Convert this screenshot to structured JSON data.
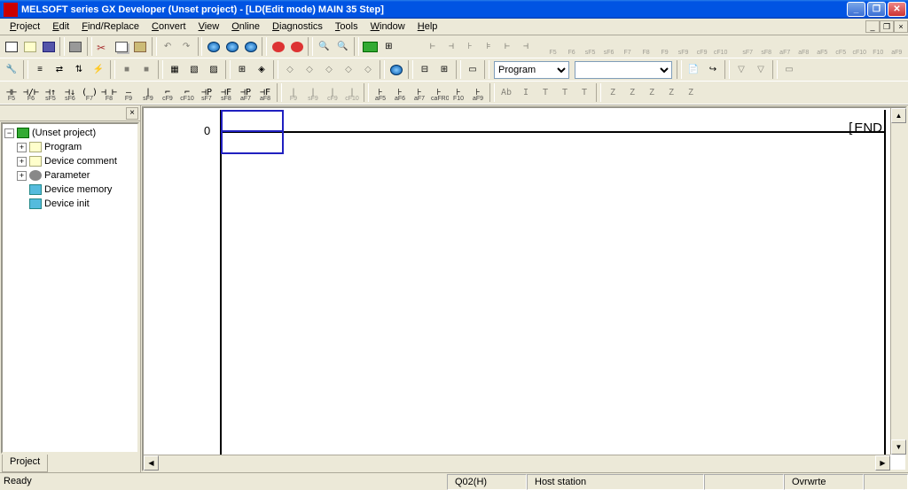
{
  "title": "MELSOFT series GX Developer (Unset project) - [LD(Edit mode)      MAIN      35 Step]",
  "menu": [
    "Project",
    "Edit",
    "Find/Replace",
    "Convert",
    "View",
    "Online",
    "Diagnostics",
    "Tools",
    "Window",
    "Help"
  ],
  "toolbar3": {
    "program_label": "Program"
  },
  "tree": {
    "root": "(Unset project)",
    "items": [
      {
        "label": "Program",
        "icon": "folder",
        "expand": "+"
      },
      {
        "label": "Device comment",
        "icon": "folder",
        "expand": "+"
      },
      {
        "label": "Parameter",
        "icon": "gear",
        "expand": "+"
      },
      {
        "label": "Device memory",
        "icon": "db",
        "expand": ""
      },
      {
        "label": "Device init",
        "icon": "db",
        "expand": ""
      }
    ],
    "bottom_tab": "Project"
  },
  "ladder": {
    "step": "0",
    "end": "END"
  },
  "ladder_keys_row1": [
    "F5",
    "F6",
    "F7",
    "F8",
    "F9",
    "sF5",
    "sF6",
    "F7",
    "F8",
    "sF9",
    "cF9",
    "cF10",
    "sF7",
    "sF8",
    "aF7",
    "aF8",
    "aF5",
    "caF5",
    "caF10",
    "F10",
    "aF9"
  ],
  "ladder_keys_row2": [
    "F5",
    "F6",
    "sF5",
    "sF6",
    "F7",
    "F8",
    "F9",
    "sF9",
    "cF9",
    "cF10",
    "sF7",
    "sF8",
    "aF7",
    "aF8"
  ],
  "ladder_keys_row3": [
    "aF5",
    "aF6",
    "aF7",
    "caFR0",
    "F10",
    "aF9"
  ],
  "status": {
    "ready": "Ready",
    "cpu": "Q02(H)",
    "station": "Host station",
    "mode": "Ovrwrte"
  }
}
